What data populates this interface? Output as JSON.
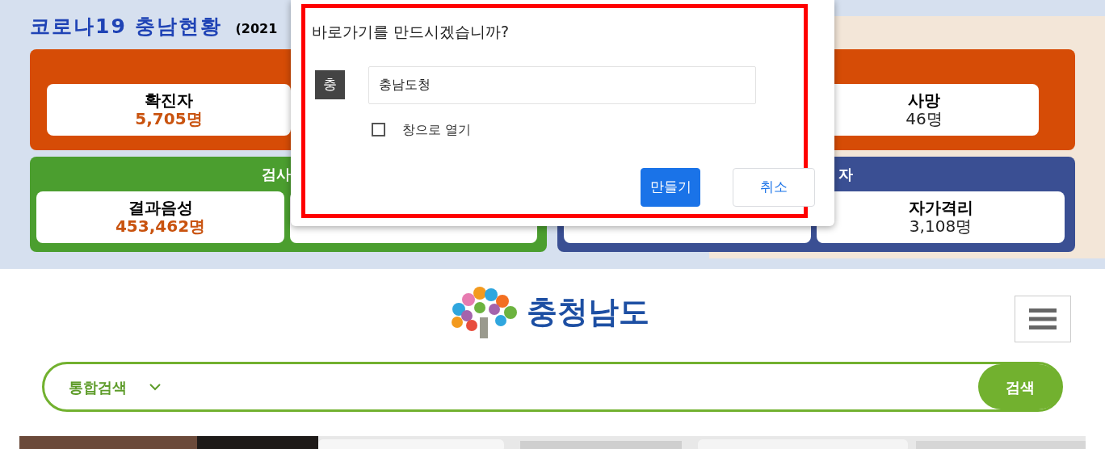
{
  "covid_status": {
    "title": "코로나19 충남현황",
    "date": "(2021",
    "cases_panel": {
      "cards": [
        {
          "label": "확진자",
          "value": "5,705명",
          "highlight": true
        },
        {
          "label": "사망",
          "value": "46명",
          "highlight": false
        }
      ]
    },
    "test_panel": {
      "title": "검사",
      "cards": [
        {
          "label": "결과음성",
          "value": "453,462명",
          "highlight": true
        }
      ]
    },
    "isolation_panel": {
      "title": "자",
      "cards": [
        {
          "label": "자가격리",
          "value": "3,108명",
          "highlight": false
        }
      ]
    }
  },
  "shortcut_dialog": {
    "title": "바로가기를 만드시겠습니까?",
    "icon_letter": "충",
    "name_field": {
      "value": "충남도청"
    },
    "open_as_window": {
      "label": "창으로 열기",
      "checked": false
    },
    "buttons": [
      {
        "label": "만들기",
        "kind": "primary"
      },
      {
        "label": "취소",
        "kind": "secondary"
      }
    ]
  },
  "site_header": {
    "logo_text": "충청남도"
  },
  "search_bar": {
    "scope": "통합검색",
    "button": "검색"
  }
}
